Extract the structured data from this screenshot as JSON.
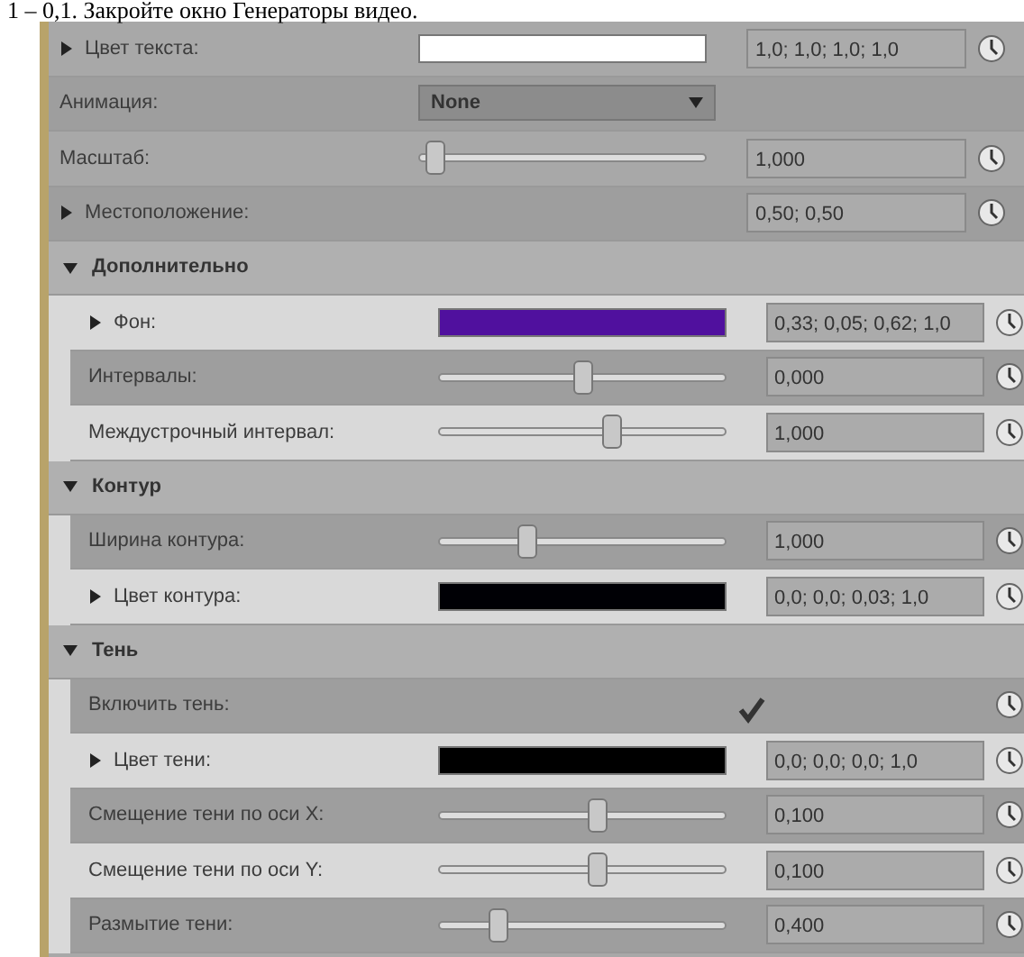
{
  "caption": "1 – 0,1. Закройте окно Генераторы видео.",
  "rows": [
    {
      "kind": "color",
      "label": "Цвет текста:",
      "expander": true,
      "color": "#ffffff",
      "value": "1,0; 1,0; 1,0; 1,0"
    },
    {
      "kind": "dropdown",
      "label": "Анимация:",
      "option": "None"
    },
    {
      "kind": "slider",
      "label": "Масштаб:",
      "level": 0.05,
      "value": "1,000"
    },
    {
      "kind": "group",
      "label": "Местоположение:",
      "expander": true,
      "value": "0,50; 0,50"
    }
  ],
  "sections": [
    {
      "title": "Дополнительно",
      "expanded": true,
      "rows": [
        {
          "kind": "color",
          "label": "Фон:",
          "expander": true,
          "color": "#50109e",
          "value": "0,33; 0,05; 0,62; 1,0"
        },
        {
          "kind": "slider",
          "label": "Интервалы:",
          "level": 0.5,
          "value": "0,000"
        },
        {
          "kind": "slider",
          "label": "Междустрочный интервал:",
          "level": 0.6,
          "value": "1,000"
        }
      ]
    },
    {
      "title": "Контур",
      "expanded": true,
      "rows": [
        {
          "kind": "slider",
          "label": "Ширина контура:",
          "level": 0.3,
          "value": "1,000"
        },
        {
          "kind": "color",
          "label": "Цвет контура:",
          "expander": true,
          "color": "#000005",
          "value": "0,0; 0,0; 0,03; 1,0"
        }
      ]
    },
    {
      "title": "Тень",
      "expanded": true,
      "rows": [
        {
          "kind": "checkbox",
          "label": "Включить тень:",
          "checked": true
        },
        {
          "kind": "color",
          "label": "Цвет тени:",
          "expander": true,
          "color": "#000000",
          "value": "0,0; 0,0; 0,0; 1,0"
        },
        {
          "kind": "slider",
          "label": "Смещение тени по оси X:",
          "level": 0.55,
          "value": "0,100"
        },
        {
          "kind": "slider",
          "label": "Смещение тени по оси Y:",
          "level": 0.55,
          "value": "0,100"
        },
        {
          "kind": "slider",
          "label": "Размытие тени:",
          "level": 0.2,
          "value": "0,400"
        }
      ]
    }
  ]
}
